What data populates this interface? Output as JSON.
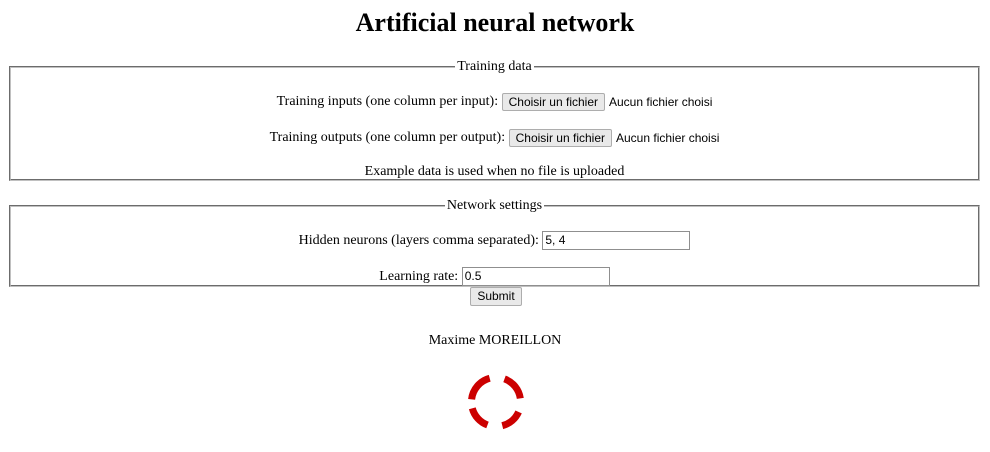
{
  "page": {
    "title": "Artificial neural network"
  },
  "training": {
    "legend": "Training data",
    "inputs_label": "Training inputs (one column per input):",
    "outputs_label": "Training outputs (one column per output):",
    "file_button_label": "Choisir un fichier",
    "no_file_text": "Aucun fichier choisi",
    "note": "Example data is used when no file is uploaded"
  },
  "network": {
    "legend": "Network settings",
    "hidden_label": "Hidden neurons (layers comma separated):",
    "hidden_value": "5, 4",
    "rate_label": "Learning rate:",
    "rate_value": "0.5"
  },
  "actions": {
    "submit_label": "Submit"
  },
  "footer": {
    "author": "Maxime MOREILLON",
    "logo_icon": "circular-arcs-logo-icon",
    "logo_color": "#cc0000"
  }
}
